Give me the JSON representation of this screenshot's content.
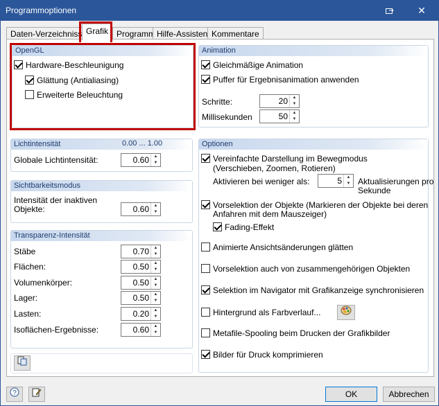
{
  "window": {
    "title": "Programmoptionen"
  },
  "tabs": [
    "Daten-Verzeichnisse",
    "Grafik",
    "Programm",
    "Hilfe-Assistent",
    "Kommentare"
  ],
  "opengl": {
    "header": "OpenGL",
    "hardware": "Hardware-Beschleunigung",
    "smoothing": "Glättung (Antialiasing)",
    "lighting": "Erweiterte Beleuchtung"
  },
  "light": {
    "header": "Lichtintensität",
    "range": "0.00 ... 1.00",
    "global_label": "Globale Lichtintensität:",
    "global_value": "0.60"
  },
  "visibility": {
    "header": "Sichtbarkeitsmodus",
    "label_line1": "Intensität der inaktiven",
    "label_line2": "Objekte:",
    "value": "0.60"
  },
  "transparency": {
    "header": "Transparenz-Intensität",
    "rows": [
      {
        "label": "Stäbe",
        "value": "0.70"
      },
      {
        "label": "Flächen:",
        "value": "0.50"
      },
      {
        "label": "Volumenkörper:",
        "value": "0.50"
      },
      {
        "label": "Lager:",
        "value": "0.50"
      },
      {
        "label": "Lasten:",
        "value": "0.20"
      },
      {
        "label": "Isoflächen-Ergebnisse:",
        "value": "0.60"
      }
    ]
  },
  "animation": {
    "header": "Animation",
    "smooth": "Gleichmäßige Animation",
    "buffer": "Puffer für Ergebnisanimation anwenden",
    "steps_label": "Schritte:",
    "steps_value": "20",
    "ms_label": "Millisekunden",
    "ms_value": "50"
  },
  "options": {
    "header": "Optionen",
    "simplified_line1": "Vereinfachte Darstellung im Bewegmodus",
    "simplified_line2": "(Verschieben, Zoomen, Rotieren)",
    "activate_label": "Aktivieren bei weniger als:",
    "activate_value": "5",
    "updates_line1": "Aktualisierungen pro",
    "updates_line2": "Sekunde",
    "preselect_line1": "Vorselektion der Objekte (Markieren der Objekte bei deren",
    "preselect_line2": "Anfahren mit dem Mauszeiger)",
    "fading": "Fading-Effekt",
    "animated_views": "Animierte Ansichtsänderungen glätten",
    "preselect_related": "Vorselektion auch von zusammengehörigen Objekten",
    "navigator_sync": "Selektion im Navigator mit Grafikanzeige synchronisieren",
    "gradient_bg": "Hintergrund als Farbverlauf...",
    "metafile": "Metafile-Spooling beim Drucken der Grafikbilder",
    "compress": "Bilder für Druck komprimieren"
  },
  "buttons": {
    "ok": "OK",
    "cancel": "Abbrechen"
  }
}
